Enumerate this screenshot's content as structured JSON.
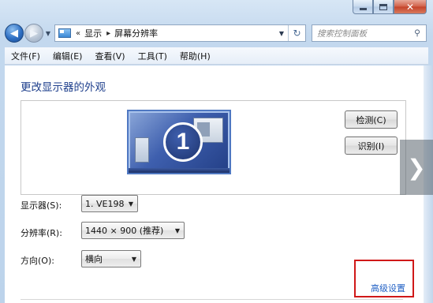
{
  "window": {
    "caption": {
      "minimize": "",
      "maximize": "",
      "close": "✕"
    }
  },
  "address_bar": {
    "overflow": "«",
    "crumbs": [
      "显示",
      "屏幕分辨率"
    ],
    "separator": "▸"
  },
  "search": {
    "placeholder": "搜索控制面板"
  },
  "menu": {
    "items": [
      "文件(F)",
      "编辑(E)",
      "查看(V)",
      "工具(T)",
      "帮助(H)"
    ]
  },
  "main": {
    "title": "更改显示器的外观",
    "monitor_number": "1",
    "detect_button": "检测(C)",
    "identify_button": "识别(I)",
    "display": {
      "label": "显示器(S):",
      "value": "1. VE198"
    },
    "resolution": {
      "label": "分辨率(R):",
      "value": "1440 × 900 (推荐)"
    },
    "orientation": {
      "label": "方向(O):",
      "value": "横向"
    },
    "advanced_link": "高级设置"
  },
  "icons": {
    "back": "back-arrow-icon",
    "forward": "forward-arrow-icon",
    "refresh": "refresh-icon",
    "search": "search-icon",
    "next": "chevron-right-icon"
  },
  "colors": {
    "title": "#1e3f8c",
    "link": "#1f5fc4",
    "highlight_box": "#d01818",
    "monitor_tile": "#3e5fae"
  }
}
